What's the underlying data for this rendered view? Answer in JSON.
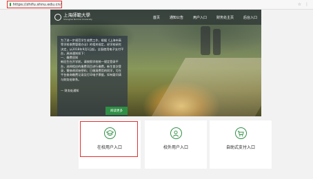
{
  "browser": {
    "url": "https://zhifu.shnu.edu.cn/"
  },
  "hero": {
    "logo_cn": "上海師範大學",
    "logo_en": "Shanghai Normal University",
    "nav": [
      "首页",
      "通知公告",
      "用户入口",
      "财务处主页",
      "后台入口"
    ],
    "notice": {
      "paragraphs": [
        "为了进一步规范学生收费工作，根据《上海市高等学校收费管理办法》的相关规定，经学校研究决定，从2018年9月1日起，全面使用电子支付平台，具体通知如下：",
        "一、缴费须知",
        "新旧生在开学前，请按照学校统一规定登录平台，选择相应的缴费项目进行缴费。新生首次登录，需修改初始密码；已缴清费用的同学，可在平台查询缴费记录及打印电子票据，如有疑问请与财务处联系。"
      ],
      "signature": "— 财务处通知",
      "button_label": "阅读更多"
    }
  },
  "entries": [
    {
      "label": "在校用户入口",
      "icon": "graduation-cap-icon"
    },
    {
      "label": "校外用户入口",
      "icon": "person-icon"
    },
    {
      "label": "自助式支付入口",
      "icon": "cart-icon"
    }
  ],
  "colors": {
    "accent_green": "#2f8f45",
    "highlight_red": "#e03030"
  }
}
